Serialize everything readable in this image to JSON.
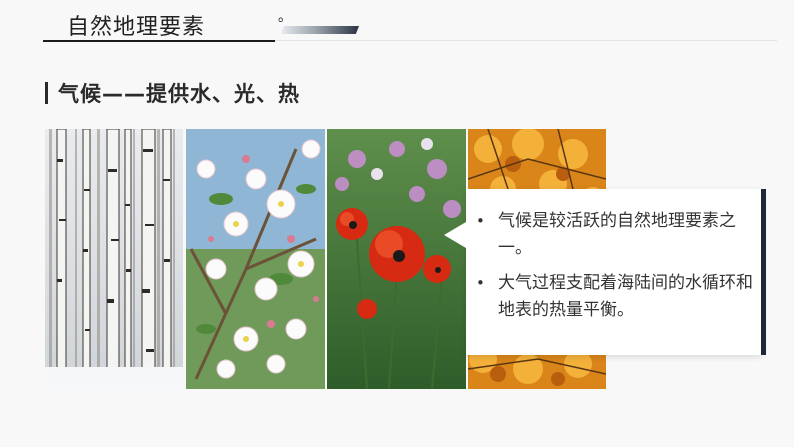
{
  "header": {
    "title": "自然地理要素",
    "mark": "。"
  },
  "section": {
    "title": "气候——提供水、光、热"
  },
  "photos": [
    {
      "subject": "winter birch forest"
    },
    {
      "subject": "spring apple blossoms"
    },
    {
      "subject": "summer red poppies"
    },
    {
      "subject": "autumn orange foliage"
    }
  ],
  "callout": {
    "bullet_symbol": "•",
    "items": [
      {
        "text": "气候是较活跃的自然地理要素之一。"
      },
      {
        "text": "大气过程支配着海陆间的水循环和地表的热量平衡。"
      }
    ]
  },
  "colors": {
    "background": "#f8f8f8",
    "heading": "#2a2a2a",
    "callout_edge": "#1f2a36",
    "callout_bg": "#ffffff"
  }
}
